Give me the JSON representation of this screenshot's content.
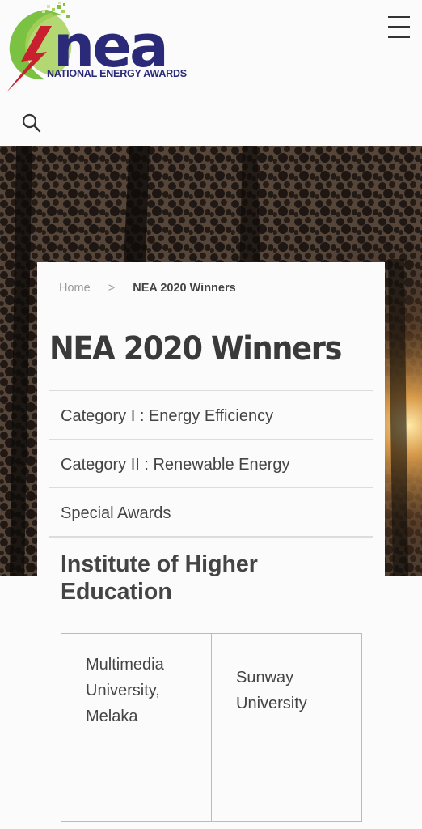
{
  "header": {
    "logo_wordmark": "nea",
    "logo_subtitle": "NATIONAL ENERGY AWARDS",
    "menu_icon": "hamburger-icon",
    "search_icon": "search-icon"
  },
  "breadcrumb": {
    "home": "Home",
    "separator": ">",
    "current": "NEA 2020 Winners"
  },
  "page": {
    "title": "NEA 2020 Winners"
  },
  "categories": [
    {
      "label": "Category I : Energy Efficiency"
    },
    {
      "label": "Category II : Renewable Energy"
    },
    {
      "label": "Special Awards"
    }
  ],
  "section": {
    "title": "Institute of Higher Education",
    "winners": [
      {
        "name": "Multimedia University, Melaka"
      },
      {
        "name": "Sunway University"
      }
    ]
  },
  "colors": {
    "brand_navy": "#2b2a78",
    "brand_green": "#7bc142",
    "brand_red": "#c8202e",
    "border": "#dcdcdc"
  }
}
